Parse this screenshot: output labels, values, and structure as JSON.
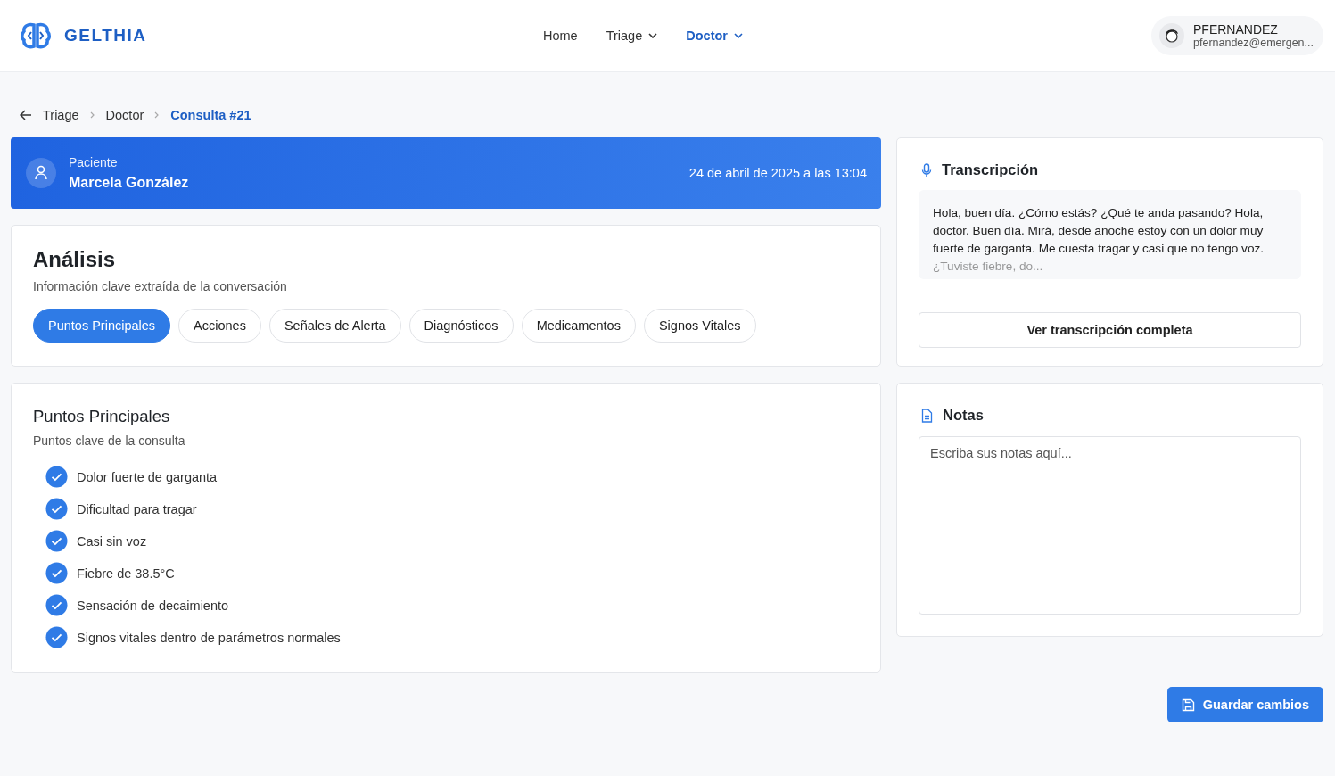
{
  "brand": {
    "name": "GELTHIA"
  },
  "nav": [
    {
      "label": "Home",
      "dropdown": false,
      "selected": false
    },
    {
      "label": "Triage",
      "dropdown": true,
      "selected": false
    },
    {
      "label": "Doctor",
      "dropdown": true,
      "selected": true
    }
  ],
  "user": {
    "name": "PFERNANDEZ",
    "email": "pfernandez@emergen..."
  },
  "breadcrumb": [
    {
      "label": "Triage",
      "selected": false
    },
    {
      "label": "Doctor",
      "selected": false
    },
    {
      "label": "Consulta #21",
      "selected": true
    }
  ],
  "patient": {
    "label": "Paciente",
    "name": "Marcela González",
    "datetime": "24 de abril de 2025 a las 13:04"
  },
  "analysis": {
    "title": "Análisis",
    "subtitle": "Información clave extraída de la conversación",
    "tabs": [
      {
        "label": "Puntos Principales",
        "selected": true
      },
      {
        "label": "Acciones",
        "selected": false
      },
      {
        "label": "Señales de Alerta",
        "selected": false
      },
      {
        "label": "Diagnósticos",
        "selected": false
      },
      {
        "label": "Medicamentos",
        "selected": false
      },
      {
        "label": "Signos Vitales",
        "selected": false
      }
    ]
  },
  "points": {
    "title": "Puntos Principales",
    "subtitle": "Puntos clave de la consulta",
    "items": [
      {
        "text": "Dolor fuerte de garganta",
        "checked": true
      },
      {
        "text": "Dificultad para tragar",
        "checked": true
      },
      {
        "text": "Casi sin voz",
        "checked": true
      },
      {
        "text": "Fiebre de 38.5°C",
        "checked": true
      },
      {
        "text": "Sensación de decaimiento",
        "checked": true
      },
      {
        "text": "Signos vitales dentro de parámetros normales",
        "checked": true
      }
    ]
  },
  "transcription": {
    "title": "Transcripción",
    "text": "Hola, buen día. ¿Cómo estás? ¿Qué te anda pasando? Hola, doctor. Buen día. Mirá, desde anoche estoy con un dolor muy fuerte de garganta. Me cuesta tragar y casi que no tengo voz. ¿Tuviste fiebre, do...",
    "button": "Ver transcripción completa"
  },
  "notes": {
    "title": "Notas",
    "placeholder": "Escriba sus notas aquí..."
  },
  "save_button": "Guardar cambios"
}
